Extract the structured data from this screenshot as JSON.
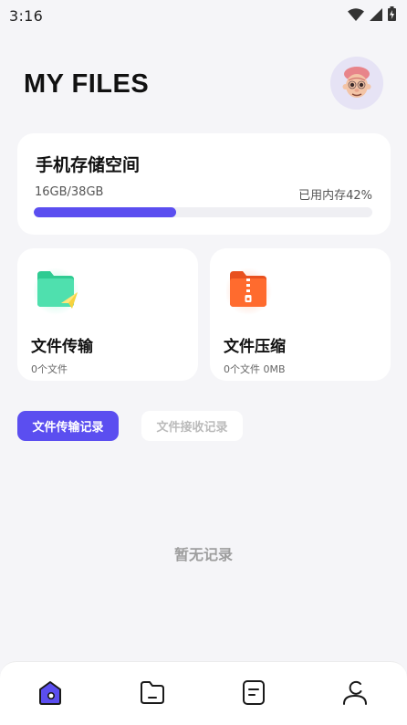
{
  "status_bar": {
    "time": "3:16",
    "icons": [
      "wifi-icon",
      "cellular-signal-icon",
      "battery-charging-icon"
    ]
  },
  "header": {
    "title": "MY FILES",
    "avatar_icon": "cartoon-avatar"
  },
  "storage": {
    "title": "手机存储空间",
    "used_text": "16GB/38GB",
    "percent_text": "已用内存42%",
    "used_fraction": 0.42,
    "bar_color": "#5B4EF0"
  },
  "cards": [
    {
      "icon": "folder-send-icon",
      "title": "文件传输",
      "subtitle": "0个文件"
    },
    {
      "icon": "zip-folder-icon",
      "title": "文件压缩",
      "subtitle": "0个文件   0MB"
    }
  ],
  "tabs": [
    {
      "label": "文件传输记录",
      "active": true
    },
    {
      "label": "文件接收记录",
      "active": false
    }
  ],
  "empty_message": "暂无记录",
  "bottom_nav": [
    {
      "icon": "home-icon",
      "active": true
    },
    {
      "icon": "folder-icon",
      "active": false
    },
    {
      "icon": "document-icon",
      "active": false
    },
    {
      "icon": "profile-icon",
      "active": false
    }
  ],
  "colors": {
    "accent": "#5B4EF0",
    "transfer_green": "#3DD9A3",
    "compress_orange": "#FF6B2E"
  }
}
